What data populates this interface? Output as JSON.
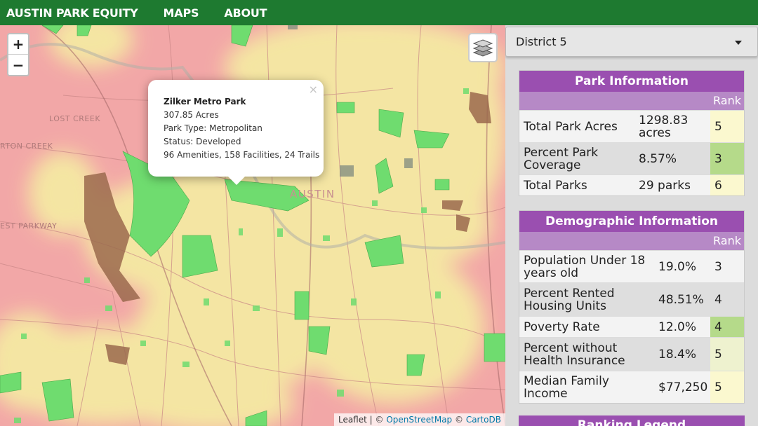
{
  "nav": {
    "brand": "AUSTIN PARK EQUITY",
    "maps": "MAPS",
    "about": "ABOUT"
  },
  "map": {
    "zoom_in": "+",
    "zoom_out": "−",
    "labels": {
      "lost_creek": "LOST CREEK",
      "barton_creek": "RTON CREEK",
      "austin": "AUSTIN",
      "parkway": "EST PARKWAY"
    },
    "popup": {
      "title": "Zilker Metro Park",
      "acres": "307.85 Acres",
      "type": "Park Type: Metropolitan",
      "status": "Status: Developed",
      "amenities": "96 Amenities, 158 Facilities, 24 Trails",
      "close": "×"
    },
    "attribution": {
      "leaflet": "Leaflet",
      "sep1": " | © ",
      "osm": "OpenStreetMap",
      "sep2": " © ",
      "carto": "CartoDB"
    }
  },
  "sidebar": {
    "district": "District 5",
    "park_info": {
      "title": "Park Information",
      "rank_header": "Rank",
      "rows": [
        {
          "label": "Total Park Acres",
          "value": "1298.83 acres",
          "rank": "5",
          "rank_color": "#fbf8cf"
        },
        {
          "label": "Percent Park Coverage",
          "value": "8.57%",
          "rank": "3",
          "rank_color": "#b5da8a"
        },
        {
          "label": "Total Parks",
          "value": "29 parks",
          "rank": "6",
          "rank_color": "#fbf8cf"
        }
      ]
    },
    "demo_info": {
      "title": "Demographic Information",
      "rank_header": "Rank",
      "rows": [
        {
          "label": "Population Under 18 years old",
          "value": "19.0%",
          "rank": "3",
          "rank_color": "#f3f3f3"
        },
        {
          "label": "Percent Rented Housing Units",
          "value": "48.51%",
          "rank": "4",
          "rank_color": "#dedede"
        },
        {
          "label": "Poverty Rate",
          "value": "12.0%",
          "rank": "4",
          "rank_color": "#b5da8a"
        },
        {
          "label": "Percent without Health Insurance",
          "value": "18.4%",
          "rank": "5",
          "rank_color": "#eef2cf"
        },
        {
          "label": "Median Family Income",
          "value": "$77,250",
          "rank": "5",
          "rank_color": "#fbf8cf"
        }
      ]
    },
    "legend_title": "Ranking Legend"
  },
  "colors": {
    "nav_bg": "#1e7a30",
    "table_header": "#9a4fb0",
    "rank_header": "#b689c6",
    "map_low": "#f2a7a7",
    "map_mid": "#f5e9a3",
    "park_green": "#6fdc6f",
    "park_brown": "#9b6a4e"
  }
}
